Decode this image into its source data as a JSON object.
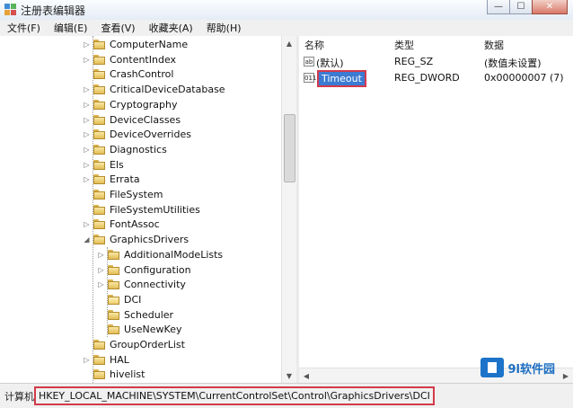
{
  "window": {
    "title": "注册表编辑器",
    "minimize": "—",
    "maximize": "☐",
    "close": "✕"
  },
  "menu": [
    "文件(F)",
    "编辑(E)",
    "查看(V)",
    "收藏夹(A)",
    "帮助(H)"
  ],
  "tree": {
    "nodes": [
      {
        "label": "ComputerName",
        "expandable": true,
        "level": 0
      },
      {
        "label": "ContentIndex",
        "expandable": true,
        "level": 0
      },
      {
        "label": "CrashControl",
        "expandable": false,
        "level": 0
      },
      {
        "label": "CriticalDeviceDatabase",
        "expandable": true,
        "level": 0
      },
      {
        "label": "Cryptography",
        "expandable": true,
        "level": 0
      },
      {
        "label": "DeviceClasses",
        "expandable": true,
        "level": 0
      },
      {
        "label": "DeviceOverrides",
        "expandable": true,
        "level": 0
      },
      {
        "label": "Diagnostics",
        "expandable": true,
        "level": 0
      },
      {
        "label": "Els",
        "expandable": true,
        "level": 0
      },
      {
        "label": "Errata",
        "expandable": true,
        "level": 0
      },
      {
        "label": "FileSystem",
        "expandable": false,
        "level": 0
      },
      {
        "label": "FileSystemUtilities",
        "expandable": false,
        "level": 0
      },
      {
        "label": "FontAssoc",
        "expandable": true,
        "level": 0
      },
      {
        "label": "GraphicsDrivers",
        "expandable": true,
        "expanded": true,
        "level": 0
      },
      {
        "label": "AdditionalModeLists",
        "expandable": true,
        "level": 1
      },
      {
        "label": "Configuration",
        "expandable": true,
        "level": 1
      },
      {
        "label": "Connectivity",
        "expandable": true,
        "level": 1
      },
      {
        "label": "DCI",
        "expandable": false,
        "selected": true,
        "level": 1
      },
      {
        "label": "Scheduler",
        "expandable": false,
        "level": 1
      },
      {
        "label": "UseNewKey",
        "expandable": false,
        "level": 1
      },
      {
        "label": "GroupOrderList",
        "expandable": false,
        "level": 0
      },
      {
        "label": "HAL",
        "expandable": true,
        "level": 0
      },
      {
        "label": "hivelist",
        "expandable": false,
        "level": 0
      }
    ]
  },
  "values": {
    "headers": {
      "name": "名称",
      "type": "类型",
      "data": "数据"
    },
    "rows": [
      {
        "icon": "ab",
        "name": "(默认)",
        "type": "REG_SZ",
        "data": "(数值未设置)",
        "selected": false
      },
      {
        "icon": "011",
        "name": "Timeout",
        "type": "REG_DWORD",
        "data": "0x00000007 (7)",
        "selected": true
      }
    ]
  },
  "status": {
    "label": "计算机",
    "path": "HKEY_LOCAL_MACHINE\\SYSTEM\\CurrentControlSet\\Control\\GraphicsDrivers\\DCI"
  },
  "watermark": {
    "text": "9l软件园"
  },
  "colors": {
    "selection": "#3b7bd2",
    "highlight_border": "#d43a4a"
  }
}
